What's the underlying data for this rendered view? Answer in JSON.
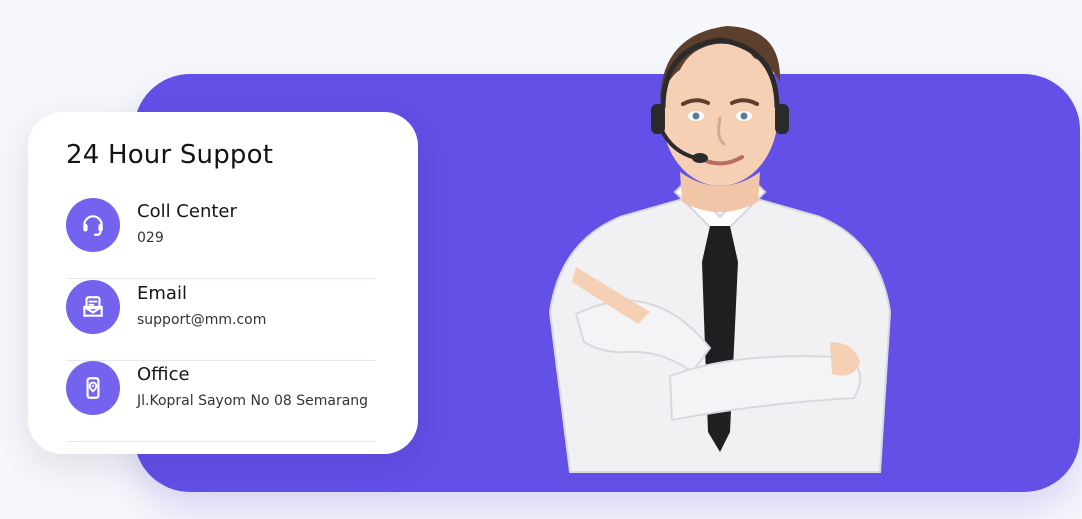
{
  "card": {
    "title": "24 Hour Suppot",
    "items": [
      {
        "label": "Coll Center",
        "value": "029",
        "icon": "headset-icon"
      },
      {
        "label": "Email",
        "value": "support@mm.com",
        "icon": "mailbox-icon"
      },
      {
        "label": "Office",
        "value": "Jl.Kopral Sayom No 08 Semarang",
        "icon": "location-phone-icon"
      }
    ]
  },
  "colors": {
    "accent": "#6250e7",
    "icon_bg": "#7463ee",
    "card_bg": "#ffffff",
    "page_bg": "#f6f7fb"
  }
}
